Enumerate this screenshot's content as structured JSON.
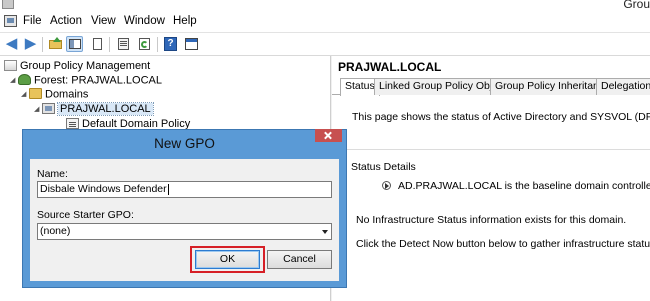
{
  "window": {
    "title": "Grou"
  },
  "menu": {
    "items": [
      "File",
      "Action",
      "View",
      "Window",
      "Help"
    ]
  },
  "toolbar": {
    "buttons": [
      "back-icon",
      "forward-icon",
      "up-folder-icon",
      "show-tree-icon",
      "properties-icon",
      "export-list-icon",
      "refresh-icon",
      "help-icon",
      "console-icon"
    ]
  },
  "tree": {
    "root": "Group Policy Management",
    "forest": "Forest: PRAJWAL.LOCAL",
    "domains": "Domains",
    "domain": "PRAJWAL.LOCAL",
    "gpo": "Default Domain Policy"
  },
  "right_pane": {
    "heading": "PRAJWAL.LOCAL",
    "tabs": [
      "Status",
      "Linked Group Policy Objects",
      "Group Policy Inheritance",
      "Delegation"
    ],
    "active_tab": "Status",
    "intro": "This page shows the status of Active Directory and SYSVOL (DFSR) replicatio",
    "status_details_label": "Status Details",
    "baseline_text": "AD.PRAJWAL.LOCAL is the baseline domain controller for this do",
    "no_info_text": "No Infrastructure Status information exists for this domain.",
    "detect_text": "Click the Detect Now button below to gather infrastructure status from all of th"
  },
  "dialog": {
    "title": "New GPO",
    "name_label": "Name:",
    "name_value": "Disbale Windows Defender",
    "starter_label": "Source Starter GPO:",
    "starter_value": "(none)",
    "ok_label": "OK",
    "cancel_label": "Cancel",
    "highlight_color": "#d61f26"
  }
}
